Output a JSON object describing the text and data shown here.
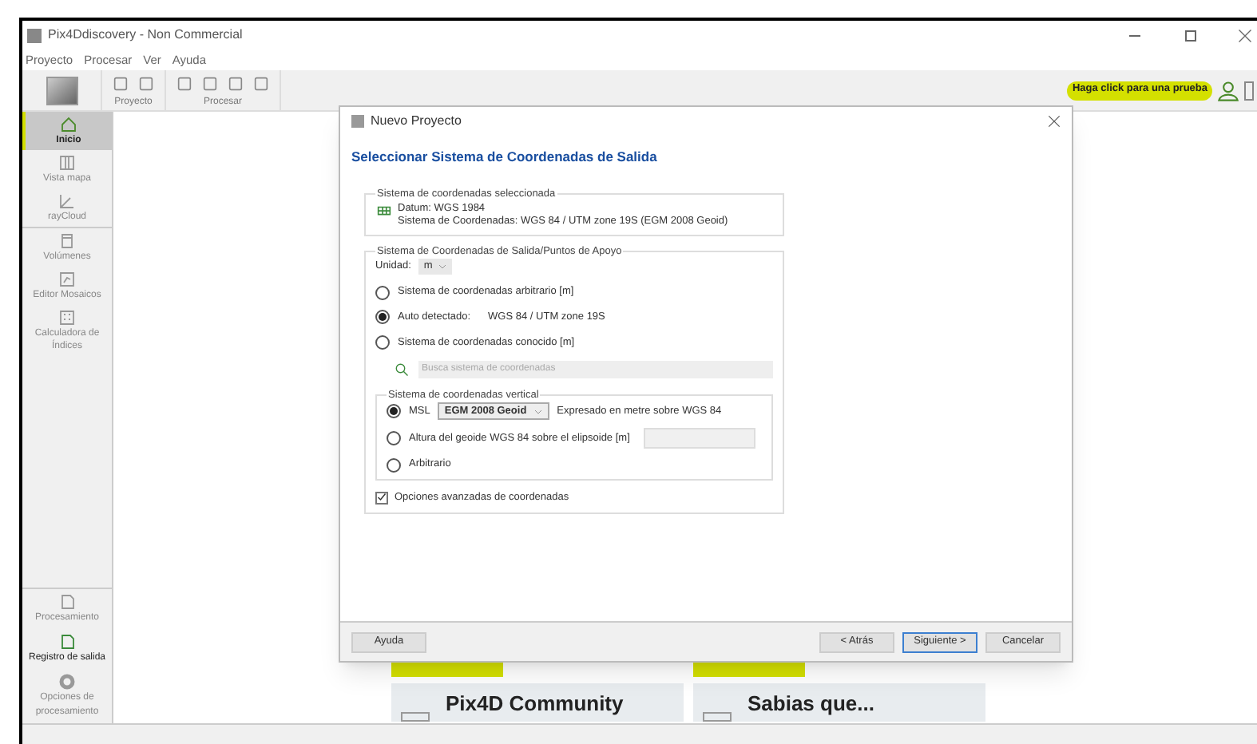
{
  "window": {
    "title": "Pix4Ddiscovery - Non Commercial"
  },
  "menu": [
    "Proyecto",
    "Procesar",
    "Ver",
    "Ayuda"
  ],
  "toolbar": {
    "groups": [
      {
        "label": "Proyecto"
      },
      {
        "label": "Procesar"
      }
    ],
    "trial_button": "Haga click para una prueba"
  },
  "sidebar": {
    "items": [
      {
        "label": "Inicio",
        "selected": true
      },
      {
        "label": "Vista mapa",
        "selected": false
      },
      {
        "label": "rayCloud",
        "selected": false
      },
      {
        "label": "Volúmenes",
        "selected": false
      },
      {
        "label": "Editor Mosaicos",
        "selected": false
      },
      {
        "label": "Calculadora de Índices",
        "selected": false
      }
    ],
    "bottom_items": [
      {
        "label": "Procesamiento",
        "selected": false
      },
      {
        "label": "Registro de salida",
        "selected": true
      },
      {
        "label": "Opciones de procesamiento",
        "selected": false
      }
    ]
  },
  "home_cards": [
    {
      "title": "Pix4D Community"
    },
    {
      "title": "Sabias que..."
    }
  ],
  "dialog": {
    "title": "Nuevo Proyecto",
    "heading": "Seleccionar Sistema de Coordenadas de Salida",
    "selected_group": {
      "title": "Sistema de coordenadas seleccionada",
      "datum": "Datum: WGS 1984",
      "system": "Sistema de Coordenadas: WGS 84 / UTM zone 19S (EGM 2008 Geoid)"
    },
    "output_group": {
      "title": "Sistema de Coordenadas de Salida/Puntos de Apoyo",
      "unit_label": "Unidad:",
      "unit_value": "m",
      "options": [
        {
          "label": "Sistema de coordenadas arbitrario [m]",
          "selected": false
        },
        {
          "label": "Auto detectado:",
          "value": "WGS 84 / UTM zone 19S",
          "selected": true
        },
        {
          "label": "Sistema de coordenadas conocido [m]",
          "selected": false
        }
      ],
      "search": {
        "placeholder": "Busca sistema de coordenadas"
      },
      "vertical": {
        "title": "Sistema de coordenadas vertical",
        "options": [
          {
            "kind": "dropdown",
            "label": "MSL",
            "selected": true,
            "dropdown": "EGM 2008 Geoid",
            "note": "Expresado en metre sobre WGS 84"
          },
          {
            "kind": "field",
            "label": "Altura del geoide WGS 84 sobre el elipsoide [m]",
            "selected": false
          },
          {
            "kind": "plain",
            "label": "Arbitrario",
            "selected": false
          }
        ]
      },
      "advanced": {
        "label": "Opciones avanzadas de coordenadas",
        "checked": true
      }
    },
    "help_button": "Ayuda",
    "buttons": [
      {
        "label": "< Atrás",
        "default": false
      },
      {
        "label": "Siguiente >",
        "default": true
      },
      {
        "label": "Cancelar",
        "default": false
      }
    ]
  }
}
